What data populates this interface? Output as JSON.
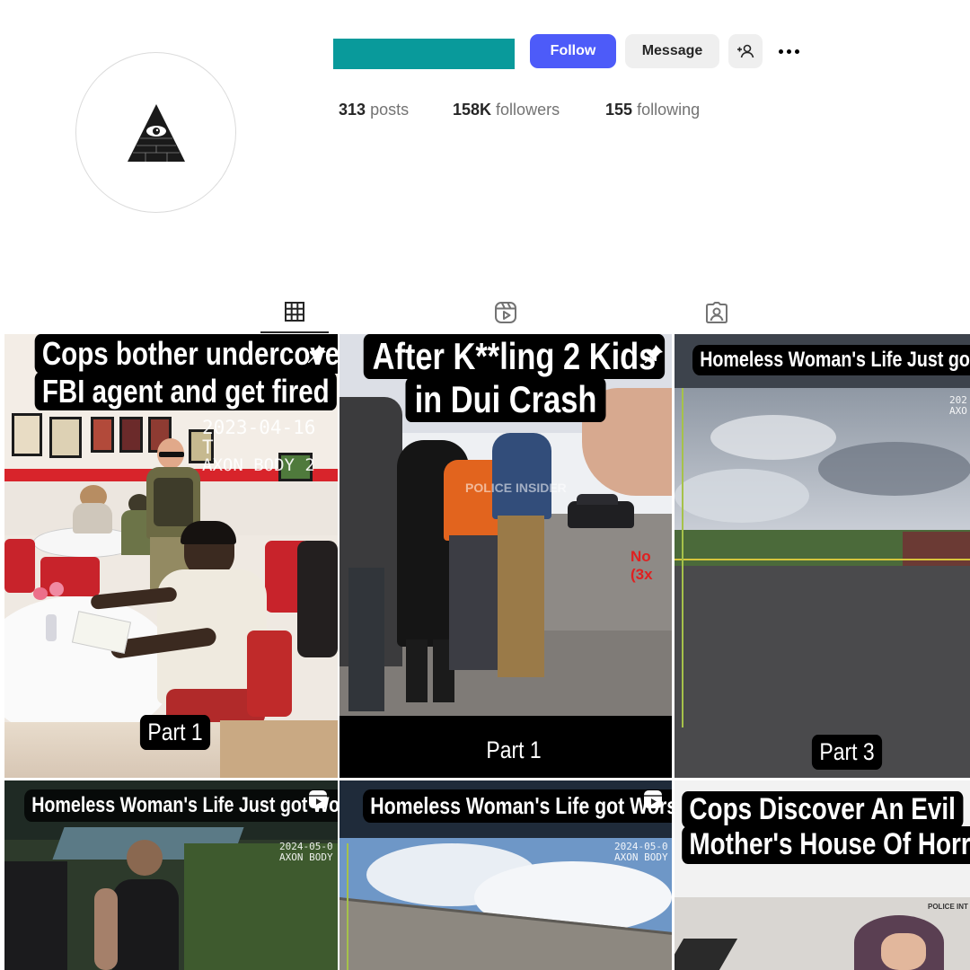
{
  "header": {
    "buttons": {
      "follow": "Follow",
      "message": "Message"
    },
    "stats": {
      "posts_count": "313",
      "posts_label": "posts",
      "followers_count": "158K",
      "followers_label": "followers",
      "following_count": "155",
      "following_label": "following"
    }
  },
  "tabs": [
    {
      "icon": "grid-icon",
      "selected": true
    },
    {
      "icon": "reels-icon",
      "selected": false
    },
    {
      "icon": "tagged-icon",
      "selected": false
    }
  ],
  "grid": {
    "posts": [
      {
        "caption_line1": "Cops bother undercover",
        "caption_line2": "FBI agent and get fired",
        "timestamp": "2023-04-16  T",
        "device": "AXON BODY 2",
        "part": "Part 1",
        "badge_icon": "pin-icon"
      },
      {
        "caption_line1": "After K**ling 2 Kids",
        "caption_line2": "in Dui Crash",
        "watermark": "POLICE INSIDER",
        "speed": "No (3x",
        "part": "Part 1",
        "badge_icon": "pin-icon"
      },
      {
        "caption": "Homeless Woman's Life Just got Worse",
        "timestamp": "202",
        "device": "AXO",
        "part": "Part 3"
      },
      {
        "caption": "Homeless Woman's Life Just got Worse",
        "timestamp": "2024-05-0",
        "device": "AXON BODY",
        "badge_icon": "reel-icon"
      },
      {
        "caption": "Homeless Woman's Life got Worse",
        "timestamp": "2024-05-0",
        "device": "AXON BODY",
        "badge_icon": "reel-icon"
      },
      {
        "caption_line1": "Cops Discover An Evil",
        "caption_line2": "Mother's House Of Horror",
        "watermark": "POLICE INT"
      }
    ]
  },
  "colors": {
    "follow_button": "#4d5bf9",
    "username_bar": "#099a9b",
    "secondary_button": "#efefef"
  }
}
